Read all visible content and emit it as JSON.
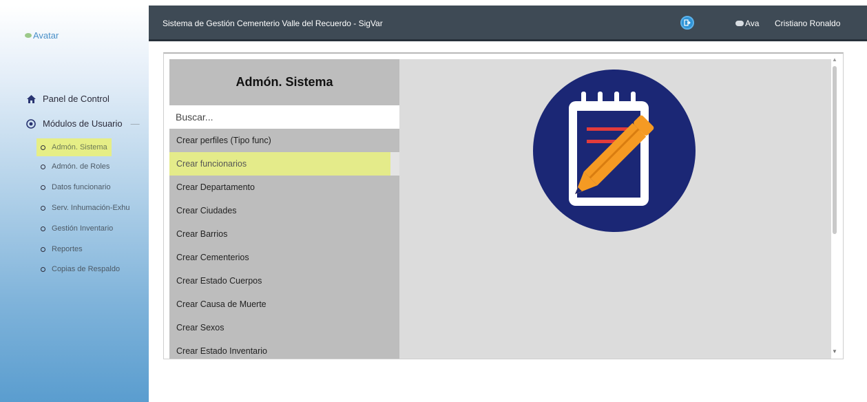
{
  "sidebar": {
    "avatar_label": "Avatar",
    "panel_label": "Panel de Control",
    "modules_label": "Módulos de Usuario",
    "modules_dash": "—",
    "items": [
      {
        "label": "Admón. Sistema"
      },
      {
        "label": "Admón. de Roles"
      },
      {
        "label": "Datos funcionario"
      },
      {
        "label": "Serv. Inhumación-Exhu"
      },
      {
        "label": "Gestión Inventario"
      },
      {
        "label": "Reportes"
      },
      {
        "label": "Copias de Respaldo"
      }
    ],
    "active_index": 0
  },
  "topbar": {
    "title": "Sistema de Gestión Cementerio Valle del Recuerdo - SigVar",
    "avatar_label": "Ava",
    "user_name": "Cristiano Ronaldo"
  },
  "panel": {
    "heading": "Admón. Sistema",
    "search_placeholder": "Buscar...",
    "items": [
      {
        "label": "Crear perfiles (Tipo func)"
      },
      {
        "label": "Crear funcionarios"
      },
      {
        "label": "Crear Departamento"
      },
      {
        "label": "Crear Ciudades"
      },
      {
        "label": "Crear Barrios"
      },
      {
        "label": "Crear Cementerios"
      },
      {
        "label": "Crear Estado Cuerpos"
      },
      {
        "label": "Crear Causa de Muerte"
      },
      {
        "label": "Crear Sexos"
      },
      {
        "label": "Crear Estado Inventario"
      }
    ],
    "highlighted_index": 1
  },
  "icons": {
    "home": "home-icon",
    "modules": "target-icon",
    "exit": "exit-icon",
    "logo": "notepad-pencil-icon"
  },
  "colors": {
    "topbar": "#3e4a55",
    "highlight": "#e4eb8a",
    "logo_circle": "#1b2775",
    "pencil": "#f59a23"
  }
}
